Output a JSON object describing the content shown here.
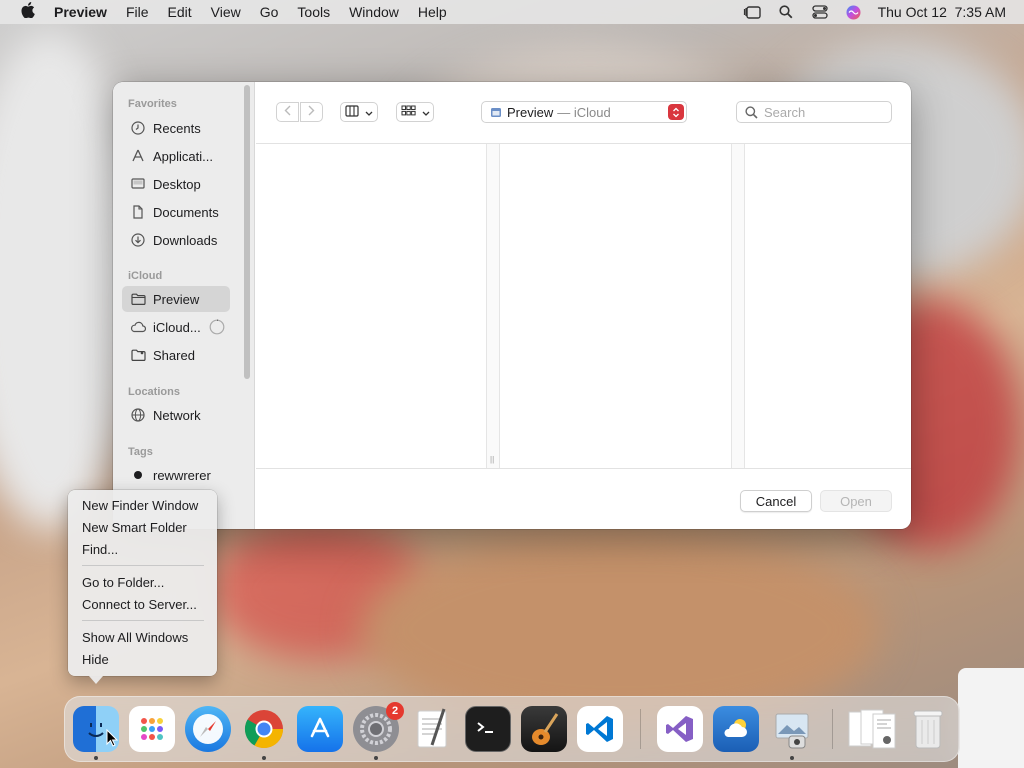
{
  "menubar": {
    "app_name": "Preview",
    "menus": [
      "File",
      "Edit",
      "View",
      "Go",
      "Tools",
      "Window",
      "Help"
    ],
    "datetime": "Thu Oct 12  7:35 AM"
  },
  "dialog": {
    "sidebar": {
      "favorites_heading": "Favorites",
      "favorites": [
        {
          "label": "Recents",
          "icon": "clock-icon"
        },
        {
          "label": "Applicati...",
          "icon": "apps-icon"
        },
        {
          "label": "Desktop",
          "icon": "desktop-icon"
        },
        {
          "label": "Documents",
          "icon": "document-icon"
        },
        {
          "label": "Downloads",
          "icon": "download-icon"
        }
      ],
      "icloud_heading": "iCloud",
      "icloud": [
        {
          "label": "Preview",
          "icon": "folder-icon",
          "selected": true
        },
        {
          "label": "iCloud...",
          "icon": "cloud-icon"
        },
        {
          "label": "Shared",
          "icon": "shared-folder-icon"
        }
      ],
      "locations_heading": "Locations",
      "locations": [
        {
          "label": "Network",
          "icon": "globe-icon"
        }
      ],
      "tags_heading": "Tags",
      "tags": [
        {
          "label": "rewwrerer",
          "color": "#1d1d1f"
        }
      ]
    },
    "toolbar": {
      "location_name": "Preview",
      "location_sub": "— iCloud",
      "search_placeholder": "Search"
    },
    "footer": {
      "cancel_label": "Cancel",
      "open_label": "Open"
    }
  },
  "context_menu": {
    "items": [
      "New Finder Window",
      "New Smart Folder",
      "Find...",
      "Go to Folder...",
      "Connect to Server...",
      "Show All Windows",
      "Hide"
    ]
  },
  "dock": {
    "apps": [
      {
        "name": "Finder",
        "icon": "finder-icon",
        "running": true
      },
      {
        "name": "Launchpad",
        "icon": "launchpad-icon"
      },
      {
        "name": "Safari",
        "icon": "safari-icon"
      },
      {
        "name": "Google Chrome",
        "icon": "chrome-icon",
        "running": true
      },
      {
        "name": "App Store",
        "icon": "appstore-icon"
      },
      {
        "name": "System Settings",
        "icon": "settings-icon",
        "running": true,
        "badge": "2"
      },
      {
        "name": "TextEdit",
        "icon": "textedit-icon"
      },
      {
        "name": "Terminal",
        "icon": "terminal-icon"
      },
      {
        "name": "GarageBand",
        "icon": "garageband-icon"
      },
      {
        "name": "Visual Studio Code",
        "icon": "vscode-icon"
      },
      {
        "name": "Visual Studio",
        "icon": "visualstudio-icon"
      },
      {
        "name": "Weather",
        "icon": "weather-icon"
      },
      {
        "name": "Preview",
        "icon": "preview-icon",
        "running": true
      },
      {
        "name": "Downloads Stack",
        "icon": "stack-icon"
      },
      {
        "name": "Trash",
        "icon": "trash-icon"
      }
    ],
    "settings_badge": "2"
  },
  "colors": {
    "accent_red": "#d9363e",
    "badge_red": "#e5392e"
  }
}
